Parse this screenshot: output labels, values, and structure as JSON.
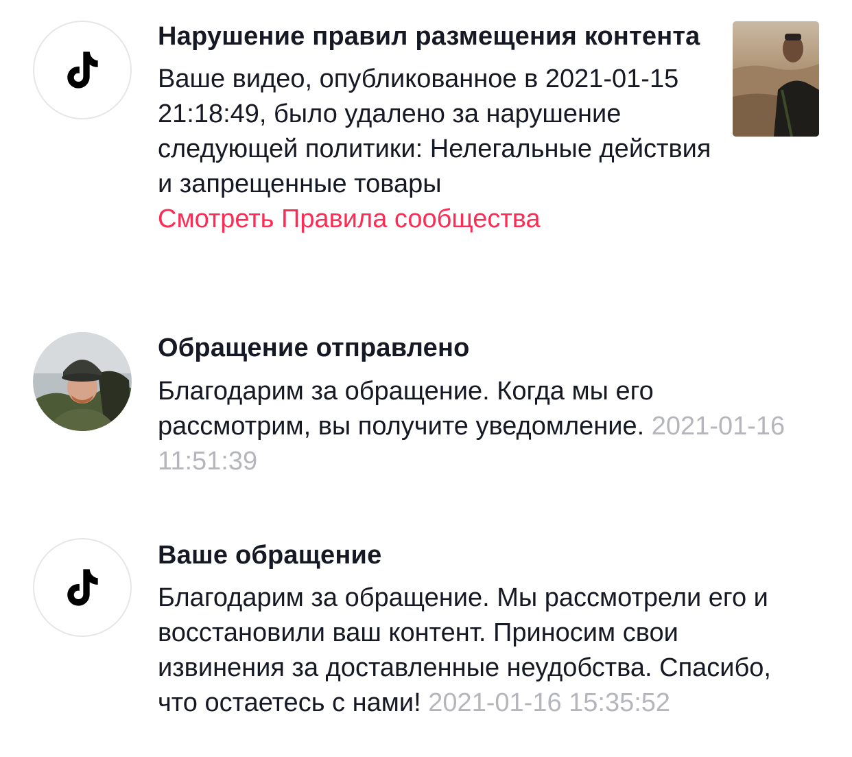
{
  "notifications": [
    {
      "title": "Нарушение правил размещения контента",
      "body": "Ваше видео, опубликованное в 2021-01-15 21:18:49, было удалено за нарушение следующей политики: Нелегальные действия и запрещенные товары",
      "link": "Смотреть Правила сообщества",
      "avatar_icon": "tiktok-logo-icon",
      "link_color": "#fe2c55"
    },
    {
      "title": "Обращение отправлено",
      "body": "Благодарим за обращение. Когда мы его рассмотрим, вы получите уведомление. ",
      "timestamp": "2021-01-16 11:51:39",
      "avatar_icon": "user-avatar"
    },
    {
      "title": "Ваше обращение",
      "body": "Благодарим за обращение. Мы рассмотрели его и восстановили ваш контент. Приносим свои извинения за доставленные неудобства. Спасибо, что остаетесь с нами! ",
      "timestamp": "2021-01-16 15:35:52",
      "avatar_icon": "tiktok-logo-icon"
    }
  ],
  "colors": {
    "text": "#161823",
    "link": "#fe2c55",
    "timestamp": "#b5b6bb",
    "avatar_border": "#e6e6e8"
  }
}
